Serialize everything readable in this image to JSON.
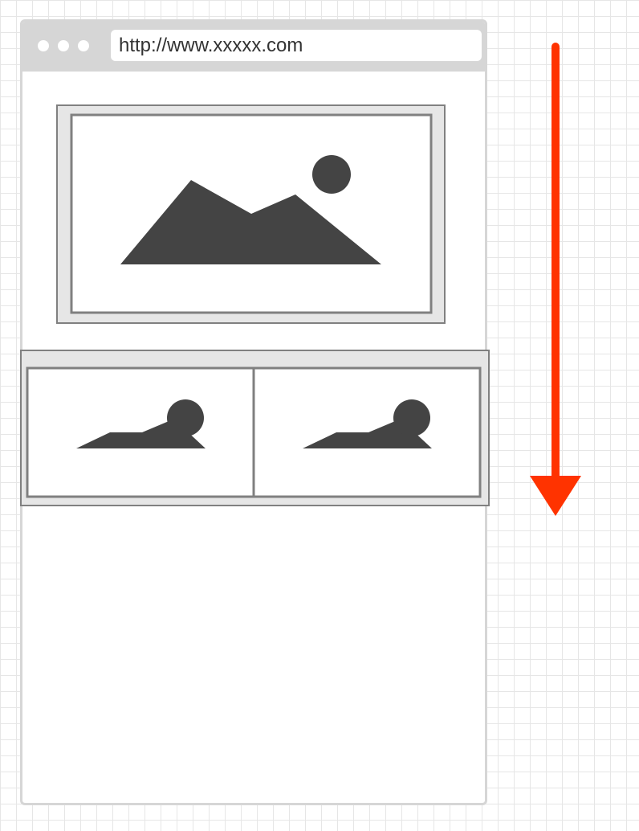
{
  "browser": {
    "url": "http://www.xxxxx.com"
  },
  "icons": {
    "window_controls": [
      "window-dot-icon",
      "window-dot-icon",
      "window-dot-icon"
    ],
    "hero_image": "image-placeholder-icon",
    "thumbnail_image": "image-placeholder-icon",
    "scroll_indicator": "arrow-down-icon"
  },
  "colors": {
    "chrome": "#d6d6d6",
    "placeholder_frame": "#808080",
    "placeholder_fill": "#e6e6e6",
    "icon_fill": "#444444",
    "arrow": "#ff3300",
    "grid": "#e6e6e6"
  }
}
